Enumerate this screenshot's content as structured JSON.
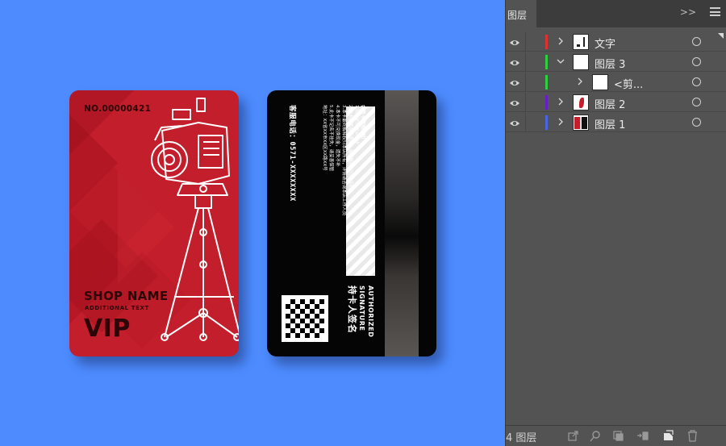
{
  "canvas": {
    "background_color": "#4d8bff",
    "front_card": {
      "card_number": "NO.00000421",
      "shop_name": "SHOP NAME",
      "additional_text": "ADDITIONAL TEXT",
      "vip_label": "VIP",
      "base_color": "#c31e2b"
    },
    "back_card": {
      "rules_title": "会员卡使用须知",
      "rules": [
        "1.结账前请出示此卡",
        "2.本卡仅限本店使用，最终解释权归本店所有",
        "3.本卡最终解释权归本店所有，详情请咨询本店工作人员",
        "4.本卡不可兑换现金，遗失不补",
        "5.此卡不记名不挂失，请妥善保管",
        "地址：XX省XX市XX区XX路XX号"
      ],
      "phone": "客服电话：0571-XXXXXXXX",
      "authorized_line1": "AUTHORIZED",
      "authorized_line2": "SIGNATURE",
      "signature_label_cn": "持卡人签名"
    }
  },
  "layers_panel": {
    "tab_label": "图层",
    "collapse_label": ">>",
    "layers": [
      {
        "name": "文字",
        "color": "#e03030",
        "expanded": false,
        "indent": 0,
        "thumb": "text"
      },
      {
        "name": "图层 3",
        "color": "#2fd03f",
        "expanded": true,
        "indent": 0,
        "thumb": "blank"
      },
      {
        "name": "<剪...",
        "color": "#2fd03f",
        "expanded": false,
        "indent": 1,
        "thumb": "blank"
      },
      {
        "name": "图层 2",
        "color": "#6a1cc8",
        "expanded": false,
        "indent": 0,
        "thumb": "feather"
      },
      {
        "name": "图层 1",
        "color": "#4a66e6",
        "expanded": false,
        "indent": 0,
        "thumb": "card"
      }
    ],
    "footer": {
      "layer_count": "4 图层",
      "icons": [
        "export-icon",
        "search-icon",
        "clip-mask-icon",
        "move-selection-icon",
        "new-layer-icon",
        "trash-icon"
      ]
    }
  }
}
